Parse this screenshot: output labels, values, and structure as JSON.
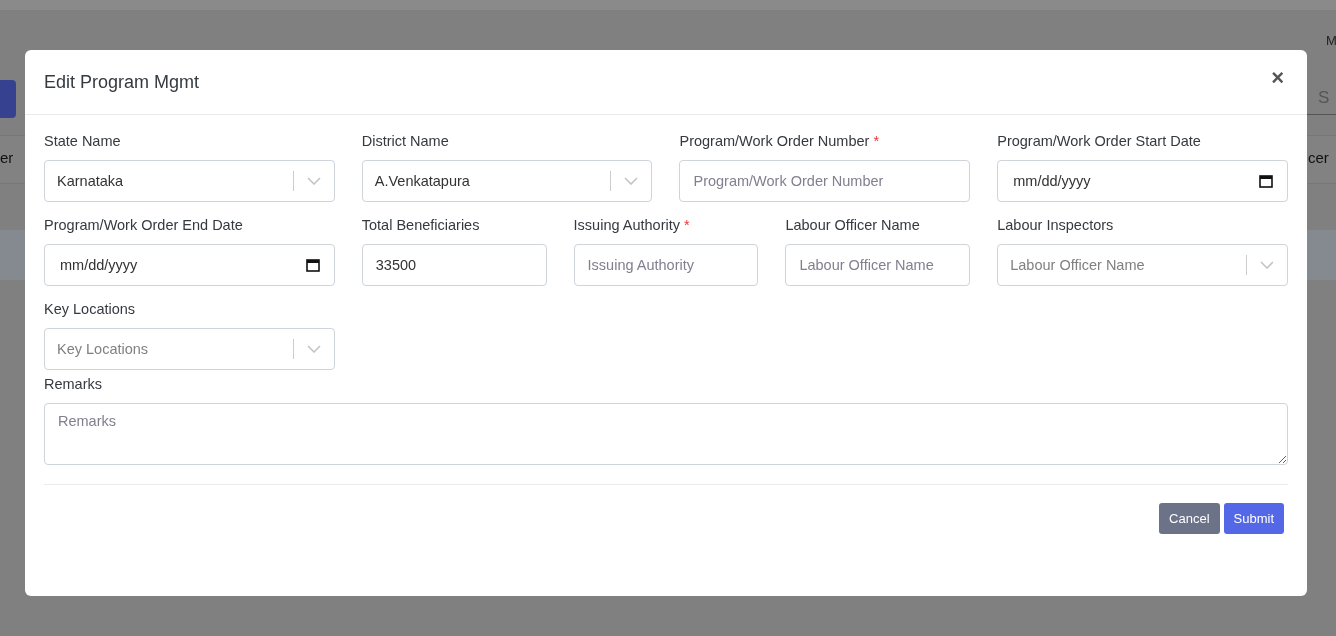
{
  "background": {
    "top_right_text": "M",
    "search_placeholder": "S",
    "left_header_fragment": "er",
    "right_header_fragment": "cer"
  },
  "modal": {
    "title": "Edit Program Mgmt",
    "close": "×",
    "fields": [
      {
        "kind": "select",
        "label": "State Name",
        "value": "Karnataka"
      },
      {
        "kind": "select",
        "label": "District Name",
        "value": "A.Venkatapura"
      },
      {
        "kind": "text",
        "label": "Program/Work Order Number",
        "required_mark": "*",
        "placeholder": "Program/Work Order Number"
      },
      {
        "kind": "date",
        "label": "Program/Work Order Start Date",
        "value": "mm/dd/yyyy"
      },
      {
        "kind": "date",
        "label": "Program/Work Order End Date",
        "value": "mm/dd/yyyy"
      },
      {
        "kind": "text",
        "label": "Total Beneficiaries",
        "value": "33500"
      },
      {
        "kind": "text",
        "label": "Issuing Authority",
        "required_mark": "*",
        "placeholder": "Issuing Authority"
      },
      {
        "kind": "text",
        "label": "Labour Officer Name",
        "placeholder": "Labour Officer Name"
      },
      {
        "kind": "select",
        "label": "Labour Inspectors",
        "placeholder": "Labour Officer Name"
      },
      {
        "kind": "select",
        "label": "Key Locations",
        "placeholder": "Key Locations"
      }
    ],
    "remarks": {
      "label": "Remarks",
      "placeholder": "Remarks"
    },
    "buttons": [
      {
        "kind": "secondary",
        "label": "Cancel"
      },
      {
        "kind": "primary",
        "label": "Submit"
      }
    ]
  }
}
